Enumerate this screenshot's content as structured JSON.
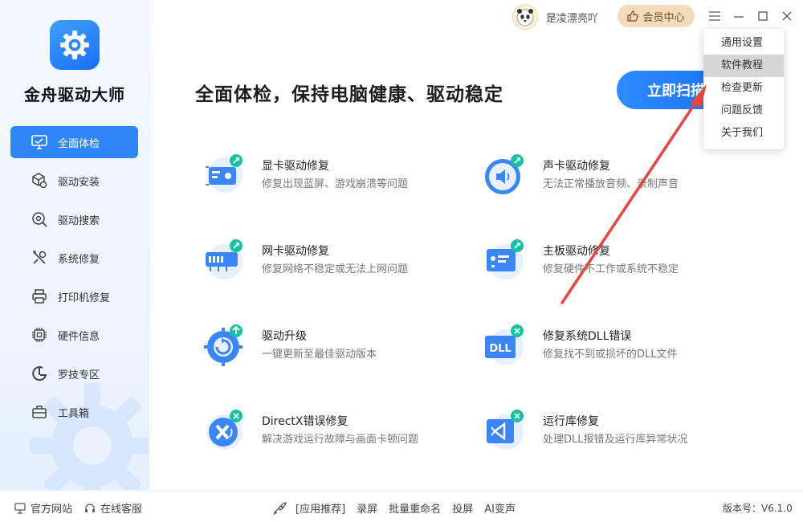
{
  "app": {
    "name": "金舟驱动大师"
  },
  "header": {
    "username": "是凌漂亮吖",
    "vip_label": "会员中心"
  },
  "menu": {
    "items": [
      "通用设置",
      "软件教程",
      "检查更新",
      "问题反馈",
      "关于我们"
    ],
    "highlighted_index": 1
  },
  "sidebar": {
    "items": [
      {
        "label": "全面体检",
        "icon": "monitor-check-icon",
        "active": true
      },
      {
        "label": "驱动安装",
        "icon": "cube-gear-icon"
      },
      {
        "label": "驱动搜索",
        "icon": "search-gear-icon"
      },
      {
        "label": "系统修复",
        "icon": "wrench-screwdriver-icon"
      },
      {
        "label": "打印机修复",
        "icon": "printer-icon"
      },
      {
        "label": "硬件信息",
        "icon": "chip-icon"
      },
      {
        "label": "罗技专区",
        "icon": "logitech-icon"
      },
      {
        "label": "工具箱",
        "icon": "toolbox-icon"
      }
    ]
  },
  "main": {
    "title": "全面体检，保持电脑健康、驱动稳定",
    "scan_button": "立即扫描",
    "features": [
      {
        "title": "显卡驱动修复",
        "desc": "修复出现蓝屏、游戏崩溃等问题",
        "icon": "graphics-card-icon"
      },
      {
        "title": "声卡驱动修复",
        "desc": "无法正常播放音频、录制声音",
        "icon": "sound-card-icon"
      },
      {
        "title": "网卡驱动修复",
        "desc": "修复网络不稳定或无法上网问题",
        "icon": "network-card-icon"
      },
      {
        "title": "主板驱动修复",
        "desc": "修复硬件不工作或系统不稳定",
        "icon": "motherboard-icon"
      },
      {
        "title": "驱动升级",
        "desc": "一键更新至最佳驱动版本",
        "icon": "driver-upgrade-icon"
      },
      {
        "title": "修复系统DLL错误",
        "desc": "修复找不到或损坏的DLL文件",
        "icon": "dll-icon",
        "icon_text": "DLL"
      },
      {
        "title": "DirectX错误修复",
        "desc": "解决游戏运行故障与画面卡顿问题",
        "icon": "directx-icon"
      },
      {
        "title": "运行库修复",
        "desc": "处理DLL报错及运行库异常状况",
        "icon": "runtime-library-icon"
      }
    ]
  },
  "footer": {
    "official_site": "官方网站",
    "online_service": "在线客服",
    "recommend_label": "[应用推荐]",
    "apps": [
      "录屏",
      "批量重命名",
      "投屏",
      "AI变声"
    ],
    "version": "版本号：V6.1.0"
  },
  "colors": {
    "accent": "#2f86f6",
    "vip_bg": "#f2dcbb",
    "arrow": "#e8463c"
  }
}
